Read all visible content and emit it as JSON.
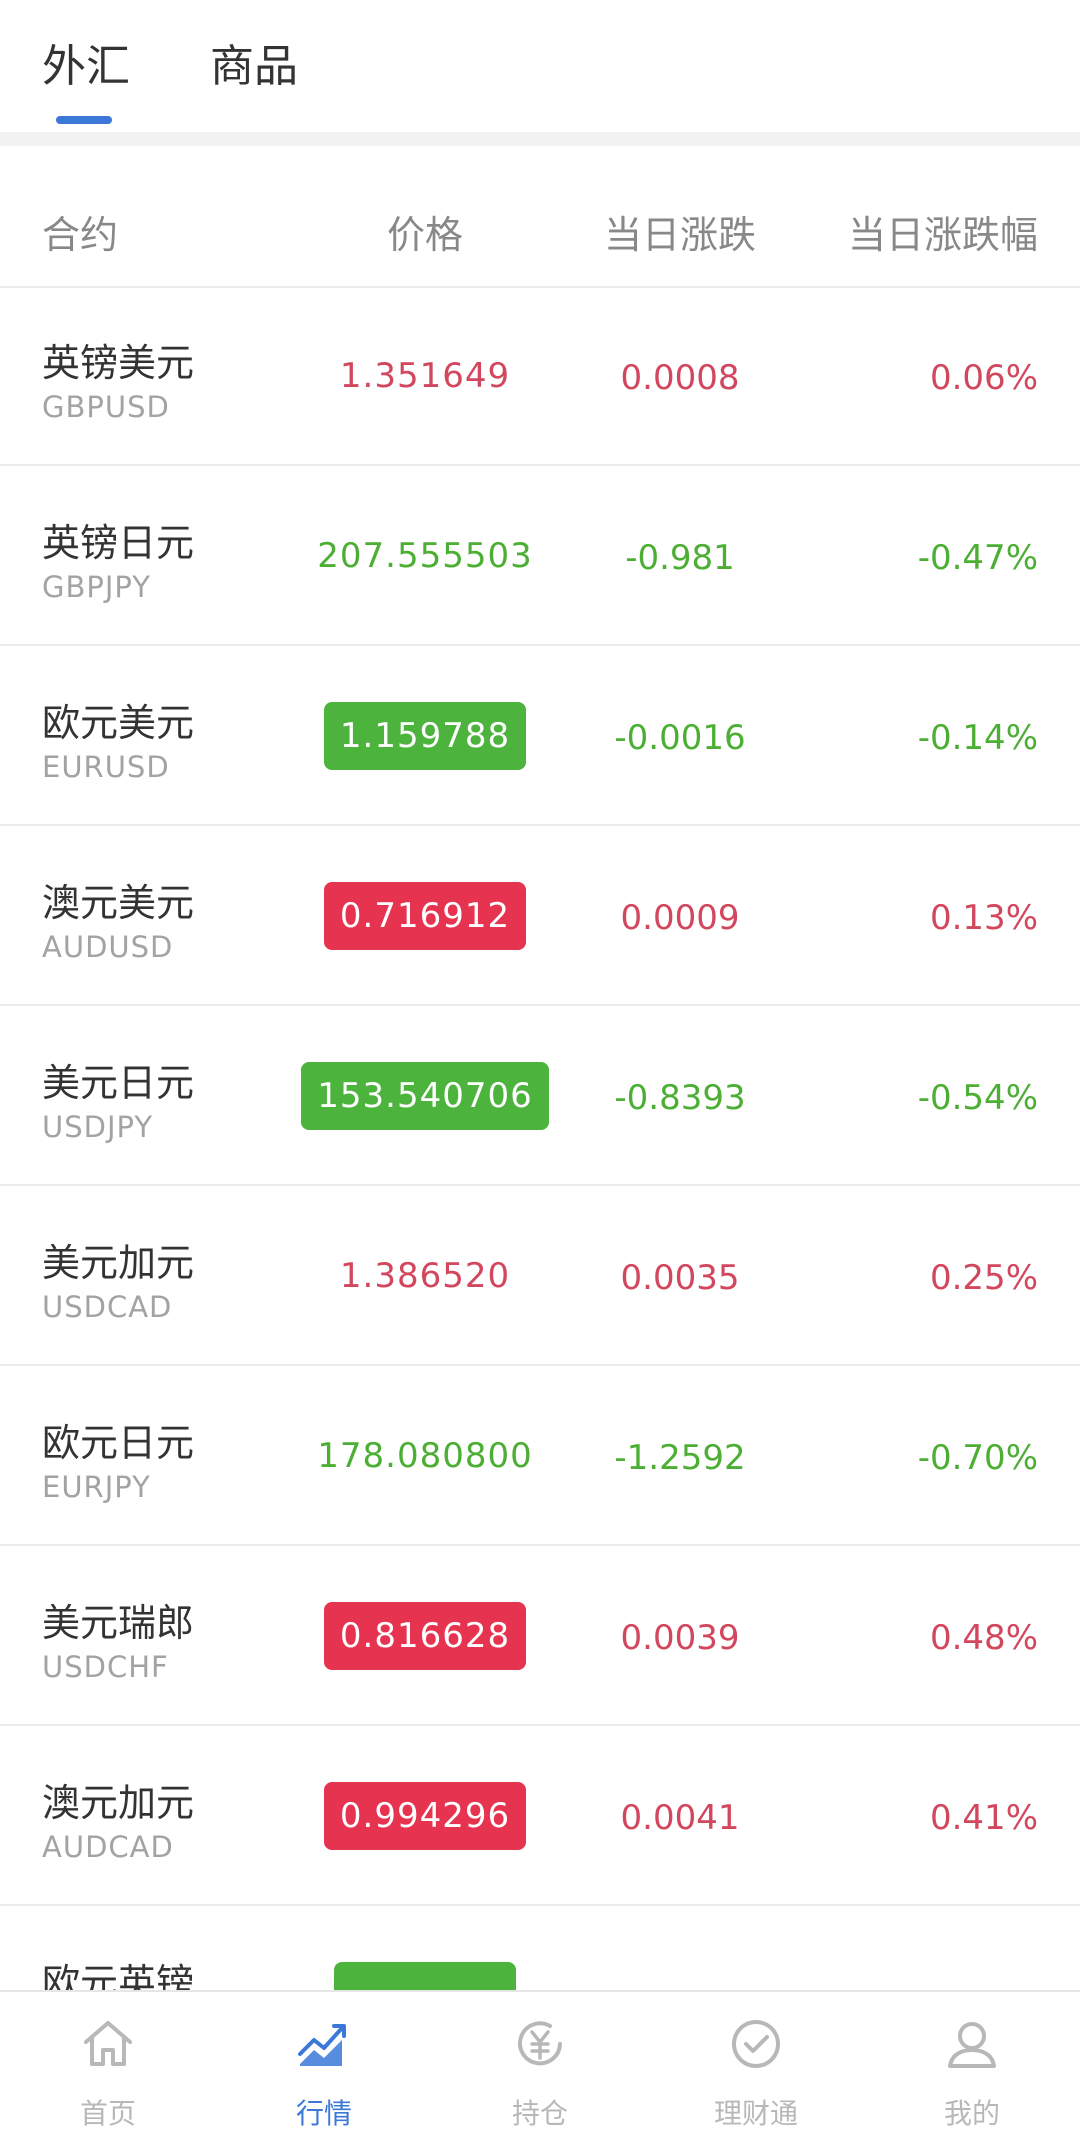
{
  "tabs": {
    "fx": "外汇",
    "goods": "商品"
  },
  "header": {
    "contract": "合约",
    "price": "价格",
    "change": "当日涨跌",
    "pct": "当日涨跌幅"
  },
  "rows": [
    {
      "name": "英镑美元",
      "code": "GBPUSD",
      "price": "1.351649",
      "change": "0.0008",
      "pct": "0.06%",
      "dir": "up",
      "flash": false
    },
    {
      "name": "英镑日元",
      "code": "GBPJPY",
      "price": "207.555503",
      "change": "-0.981",
      "pct": "-0.47%",
      "dir": "down",
      "flash": false
    },
    {
      "name": "欧元美元",
      "code": "EURUSD",
      "price": "1.159788",
      "change": "-0.0016",
      "pct": "-0.14%",
      "dir": "down",
      "flash": true
    },
    {
      "name": "澳元美元",
      "code": "AUDUSD",
      "price": "0.716912",
      "change": "0.0009",
      "pct": "0.13%",
      "dir": "up",
      "flash": true
    },
    {
      "name": "美元日元",
      "code": "USDJPY",
      "price": "153.540706",
      "change": "-0.8393",
      "pct": "-0.54%",
      "dir": "down",
      "flash": true
    },
    {
      "name": "美元加元",
      "code": "USDCAD",
      "price": "1.386520",
      "change": "0.0035",
      "pct": "0.25%",
      "dir": "up",
      "flash": false
    },
    {
      "name": "欧元日元",
      "code": "EURJPY",
      "price": "178.080800",
      "change": "-1.2592",
      "pct": "-0.70%",
      "dir": "down",
      "flash": false
    },
    {
      "name": "美元瑞郎",
      "code": "USDCHF",
      "price": "0.816628",
      "change": "0.0039",
      "pct": "0.48%",
      "dir": "up",
      "flash": true
    },
    {
      "name": "澳元加元",
      "code": "AUDCAD",
      "price": "0.994296",
      "change": "0.0041",
      "pct": "0.41%",
      "dir": "up",
      "flash": true
    },
    {
      "name": "欧元英镑",
      "code": "",
      "price": "",
      "change": "",
      "pct": "",
      "dir": "down",
      "flash": true
    }
  ],
  "nav": {
    "home": "首页",
    "market": "行情",
    "position": "持仓",
    "finance": "理财通",
    "mine": "我的"
  },
  "colors": {
    "up": "#d2475e",
    "down": "#4caf34",
    "accent": "#3b78d8"
  }
}
